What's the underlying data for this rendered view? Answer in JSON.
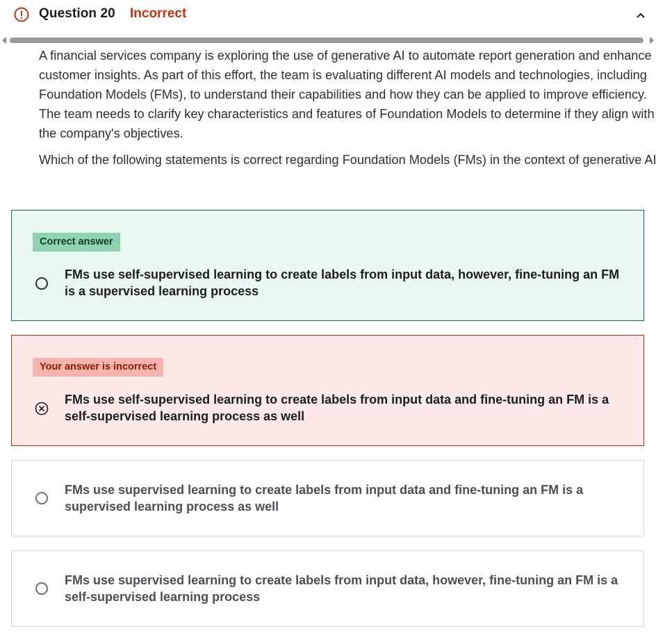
{
  "header": {
    "question_label": "Question 20",
    "status": "Incorrect",
    "status_color": "#c4310c",
    "icons": {
      "status": "alert-circle-icon",
      "collapse": "chevron-up-icon"
    }
  },
  "question": {
    "paragraph": "A financial services company is exploring the use of generative AI to automate report generation and enhance customer insights. As part of this effort, the team is evaluating different AI models and technologies, including Foundation Models (FMs), to understand their capabilities and how they can be applied to improve efficiency. The team needs to clarify key characteristics and features of Foundation Models to determine if they align with the company's objectives.",
    "prompt": "Which of the following statements is correct regarding Foundation Models (FMs) in the context of generative AI?"
  },
  "answers": [
    {
      "badge": "Correct answer",
      "text": "FMs use self-supervised learning to create labels from input data, however, fine-tuning an FM is a supervised learning process",
      "state": "correct",
      "color": "#e9f8f1"
    },
    {
      "badge": "Your answer is incorrect",
      "text": "FMs use self-supervised learning to create labels from input data and fine-tuning an FM is a self-supervised learning process as well",
      "state": "selected-incorrect",
      "color": "#fde9e8"
    },
    {
      "text": "FMs use supervised learning to create labels from input data and fine-tuning an FM is a supervised learning process as well",
      "state": "unselected"
    },
    {
      "text": "FMs use supervised learning to create labels from input data, however, fine-tuning an FM is a self-supervised learning process",
      "state": "unselected"
    }
  ]
}
